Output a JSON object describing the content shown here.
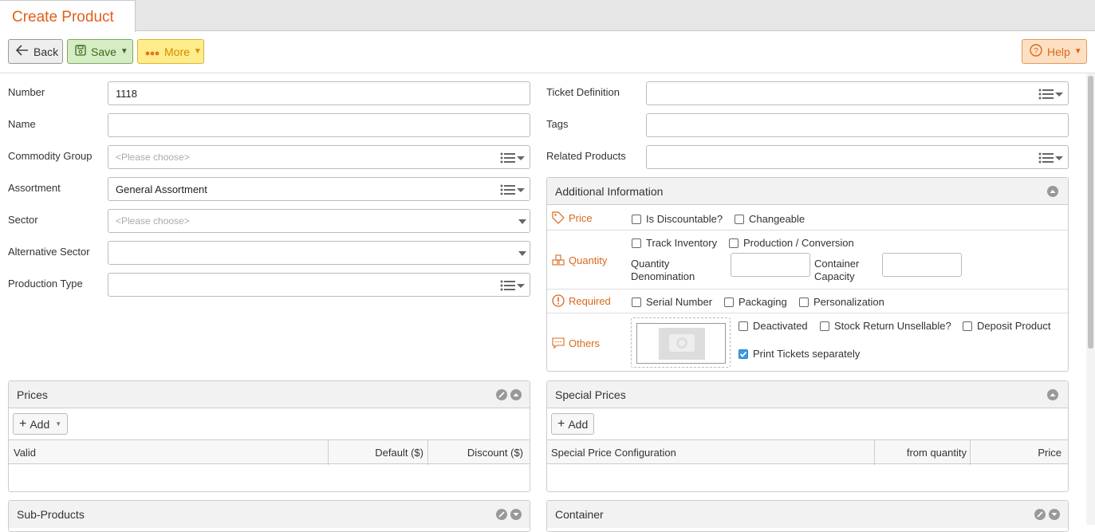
{
  "tab": {
    "title": "Create Product"
  },
  "toolbar": {
    "back_label": "Back",
    "save_label": "Save",
    "more_label": "More",
    "help_label": "Help"
  },
  "form": {
    "number_label": "Number",
    "number_value": "1118",
    "name_label": "Name",
    "name_value": "",
    "commodity_label": "Commodity Group",
    "commodity_placeholder": "<Please choose>",
    "assortment_label": "Assortment",
    "assortment_value": "General Assortment",
    "sector_label": "Sector",
    "sector_placeholder": "<Please choose>",
    "alt_sector_label": "Alternative Sector",
    "production_type_label": "Production Type",
    "ticket_def_label": "Ticket Definition",
    "tags_label": "Tags",
    "related_label": "Related Products"
  },
  "additional": {
    "title": "Additional Information",
    "price_label": "Price",
    "is_discountable": "Is Discountable?",
    "changeable": "Changeable",
    "quantity_label": "Quantity",
    "track_inventory": "Track Inventory",
    "production_conversion": "Production / Conversion",
    "qty_denomination_1": "Quantity",
    "qty_denomination_2": "Denomination",
    "container_capacity_1": "Container",
    "container_capacity_2": "Capacity",
    "required_label": "Required",
    "serial_number": "Serial Number",
    "packaging": "Packaging",
    "personalization": "Personalization",
    "others_label": "Others",
    "deactivated": "Deactivated",
    "stock_return": "Stock Return Unsellable?",
    "deposit_product": "Deposit Product",
    "print_tickets": "Print Tickets separately",
    "print_tickets_checked": true
  },
  "prices": {
    "title": "Prices",
    "add_label": "Add",
    "columns": [
      "Valid",
      "Default ($)",
      "Discount ($)"
    ]
  },
  "special_prices": {
    "title": "Special Prices",
    "add_label": "Add",
    "columns": [
      "Special Price Configuration",
      "from quantity",
      "Price"
    ]
  },
  "sub_products": {
    "title": "Sub-Products"
  },
  "container": {
    "title": "Container"
  },
  "colors": {
    "accent": "#e0601b",
    "label_orange": "#d9681c",
    "checkbox_on": "#3c9be0"
  }
}
